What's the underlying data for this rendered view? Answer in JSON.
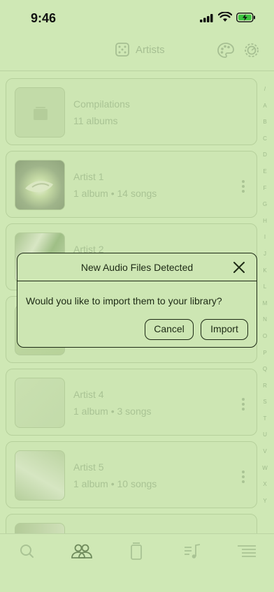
{
  "status": {
    "time": "9:46"
  },
  "header": {
    "title": "Artists"
  },
  "artists": [
    {
      "name": "Compilations",
      "meta": "11 albums"
    },
    {
      "name": "Artist 1",
      "meta": "1 album • 14 songs"
    },
    {
      "name": "Artist 2",
      "meta": ""
    },
    {
      "name": "",
      "meta": ""
    },
    {
      "name": "Artist 4",
      "meta": "1 album • 3 songs"
    },
    {
      "name": "Artist 5",
      "meta": "1 album • 10 songs"
    },
    {
      "name": "",
      "meta": ""
    }
  ],
  "index_letters": [
    "/",
    "A",
    "B",
    "C",
    "D",
    "E",
    "F",
    "G",
    "H",
    "I",
    "J",
    "K",
    "L",
    "M",
    "N",
    "O",
    "P",
    "Q",
    "R",
    "S",
    "T",
    "U",
    "V",
    "W",
    "X",
    "Y"
  ],
  "dialog": {
    "title": "New Audio Files Detected",
    "message": "Would you like to import them to your library?",
    "cancel_label": "Cancel",
    "import_label": "Import"
  },
  "colors": {
    "background": "#cfe8b5",
    "dialog_border": "#1d2a15",
    "muted": "#a9c394"
  }
}
